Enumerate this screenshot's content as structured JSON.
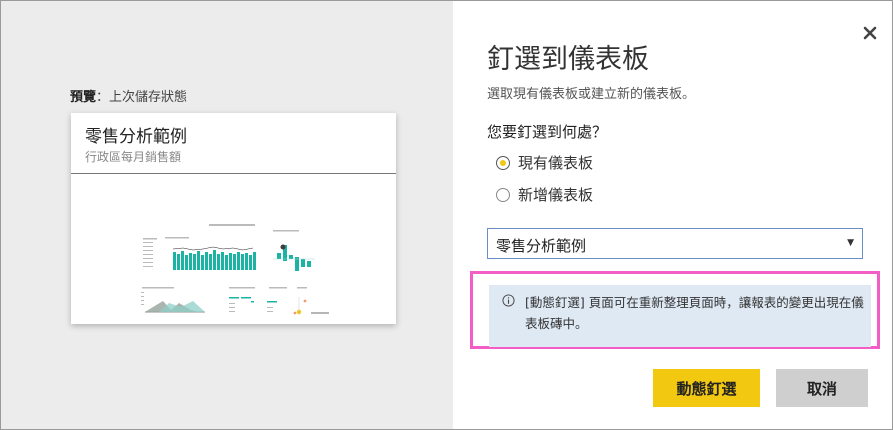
{
  "preview": {
    "label_bold": "預覽",
    "label_rest": "：上次儲存狀態",
    "tile_title": "零售分析範例",
    "tile_subtitle": "行政區每月銷售額"
  },
  "dialog": {
    "title": "釘選到儀表板",
    "description": "選取現有儀表板或建立新的儀表板。",
    "question": "您要釘選到何處？",
    "options": [
      {
        "label": "現有儀表板",
        "checked": true
      },
      {
        "label": "新增儀表板",
        "checked": false
      }
    ],
    "dashboard_select_value": "零售分析範例",
    "info_text": "[動態釘選] 頁面可在重新整理頁面時，讓報表的變更出現在儀表板磚中。",
    "pin_live_button": "動態釘選",
    "cancel_button": "取消"
  },
  "colors": {
    "accent_yellow": "#f2c811",
    "highlight_pink": "#f25ec5",
    "info_bg": "#dfe9f4",
    "chart_teal": "#1ab3a4"
  }
}
